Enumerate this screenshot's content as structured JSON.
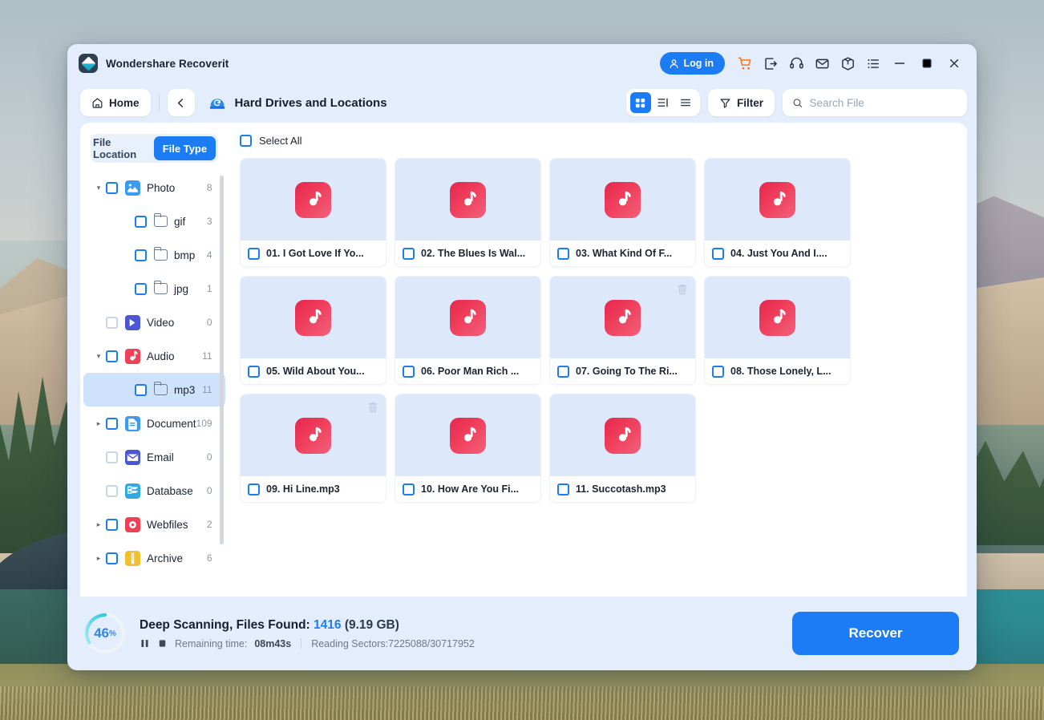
{
  "app": {
    "title": "Wondershare Recoverit",
    "logo_icon": "wondershare-diamond-icon"
  },
  "titlebar": {
    "login_label": "Log in",
    "icons": [
      {
        "name": "cart-icon",
        "label": "Shopping Cart"
      },
      {
        "name": "export-icon",
        "label": "Export"
      },
      {
        "name": "headset-icon",
        "label": "Support"
      },
      {
        "name": "mail-icon",
        "label": "Mail"
      },
      {
        "name": "box-icon",
        "label": "Products"
      },
      {
        "name": "list-menu-icon",
        "label": "Menu"
      }
    ],
    "window_controls": [
      {
        "name": "minimize-icon",
        "label": "Minimize"
      },
      {
        "name": "maximize-icon",
        "label": "Maximize"
      },
      {
        "name": "close-icon",
        "label": "Close"
      }
    ]
  },
  "navbar": {
    "home_label": "Home",
    "back_icon": "chevron-left-icon",
    "location_icon": "hard-drive-icon",
    "location_title": "Hard Drives and Locations",
    "views": [
      {
        "name": "grid-view",
        "icon": "grid-icon",
        "active": true
      },
      {
        "name": "detail-view",
        "icon": "list-detail-icon",
        "active": false
      },
      {
        "name": "list-view",
        "icon": "list-icon",
        "active": false
      }
    ],
    "filter_label": "Filter",
    "filter_icon": "funnel-icon",
    "search_icon": "search-icon",
    "search_placeholder": "Search File",
    "search_value": ""
  },
  "sidebar": {
    "tabs": [
      {
        "label": "File Location",
        "active": false
      },
      {
        "label": "File Type",
        "active": true
      }
    ],
    "tree": [
      {
        "label": "Photo",
        "count": "8",
        "level": 0,
        "caret": "down",
        "icon": "photo-icon",
        "icon_color": "#3a9bf0",
        "checkbox": "blue",
        "selected": false
      },
      {
        "label": "gif",
        "count": "3",
        "level": 1,
        "caret": "none",
        "icon": "folder-icon",
        "icon_color": "",
        "checkbox": "blue",
        "selected": false
      },
      {
        "label": "bmp",
        "count": "4",
        "level": 1,
        "caret": "none",
        "icon": "folder-icon",
        "icon_color": "",
        "checkbox": "blue",
        "selected": false
      },
      {
        "label": "jpg",
        "count": "1",
        "level": 1,
        "caret": "none",
        "icon": "folder-icon",
        "icon_color": "",
        "checkbox": "blue",
        "selected": false
      },
      {
        "label": "Video",
        "count": "0",
        "level": 0,
        "caret": "none",
        "icon": "video-icon",
        "icon_color": "#4a56d6",
        "checkbox": "dim",
        "selected": false
      },
      {
        "label": "Audio",
        "count": "11",
        "level": 0,
        "caret": "down",
        "icon": "audio-icon",
        "icon_color": "#ef4056",
        "checkbox": "blue",
        "selected": false
      },
      {
        "label": "mp3",
        "count": "11",
        "level": 1,
        "caret": "none",
        "icon": "folder-icon",
        "icon_color": "",
        "checkbox": "blue",
        "selected": true
      },
      {
        "label": "Document",
        "count": "109",
        "level": 0,
        "caret": "right",
        "icon": "document-icon",
        "icon_color": "#3a9bf0",
        "checkbox": "blue",
        "selected": false
      },
      {
        "label": "Email",
        "count": "0",
        "level": 0,
        "caret": "none",
        "icon": "email-icon",
        "icon_color": "#4a56d6",
        "checkbox": "dim",
        "selected": false
      },
      {
        "label": "Database",
        "count": "0",
        "level": 0,
        "caret": "none",
        "icon": "database-icon",
        "icon_color": "#2eaae0",
        "checkbox": "dim",
        "selected": false
      },
      {
        "label": "Webfiles",
        "count": "2",
        "level": 0,
        "caret": "right",
        "icon": "webfile-icon",
        "icon_color": "#ef4056",
        "checkbox": "blue",
        "selected": false
      },
      {
        "label": "Archive",
        "count": "6",
        "level": 0,
        "caret": "right",
        "icon": "archive-icon",
        "icon_color": "#f0c030",
        "checkbox": "blue",
        "selected": false
      }
    ]
  },
  "content": {
    "select_all_label": "Select All",
    "files": [
      {
        "name": "01. I Got Love If Yo...",
        "icon": "mp3-file-icon",
        "deleted_badge": false
      },
      {
        "name": "02. The Blues Is Wal...",
        "icon": "mp3-file-icon",
        "deleted_badge": false
      },
      {
        "name": "03. What Kind Of F...",
        "icon": "mp3-file-icon",
        "deleted_badge": false
      },
      {
        "name": "04. Just You And I....",
        "icon": "mp3-file-icon",
        "deleted_badge": false
      },
      {
        "name": "05. Wild About You...",
        "icon": "mp3-file-icon",
        "deleted_badge": false
      },
      {
        "name": "06. Poor Man Rich ...",
        "icon": "mp3-file-icon",
        "deleted_badge": false
      },
      {
        "name": "07. Going To The Ri...",
        "icon": "mp3-file-icon",
        "deleted_badge": true
      },
      {
        "name": "08. Those Lonely, L...",
        "icon": "mp3-file-icon",
        "deleted_badge": false
      },
      {
        "name": "09. Hi Line.mp3",
        "icon": "mp3-file-icon",
        "deleted_badge": true
      },
      {
        "name": "10. How Are You Fi...",
        "icon": "mp3-file-icon",
        "deleted_badge": false
      },
      {
        "name": "11. Succotash.mp3",
        "icon": "mp3-file-icon",
        "deleted_badge": false
      }
    ]
  },
  "status": {
    "progress_value": "46",
    "progress_unit": "%",
    "scan_label": "Deep Scanning, Files Found:",
    "files_found": "1416",
    "size": "(9.19 GB)",
    "pause_icon": "pause-icon",
    "stop_icon": "stop-icon",
    "remaining_label": "Remaining time:",
    "remaining_value": "08m43s",
    "sectors_text": "Reading Sectors:7225088/30717952",
    "recover_label": "Recover"
  },
  "colors": {
    "accent_blue": "#1b7cf5",
    "progress_cyan": "#3fd0e0",
    "mp3_red": "#ef3f5c",
    "window_bg": "#e4edfb",
    "thumb_bg": "#dde8fa",
    "selected_row": "#cfe2fb"
  }
}
